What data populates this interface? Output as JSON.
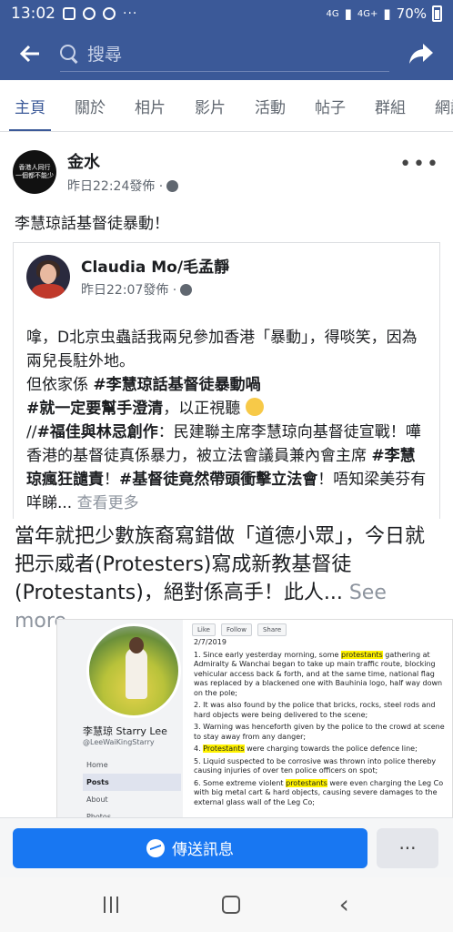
{
  "status_bar": {
    "time": "13:02",
    "dots": "···",
    "signal1": "4G",
    "signal2": "4G+",
    "battery": "70%"
  },
  "appbar": {
    "search_placeholder": "搜尋"
  },
  "tabs": [
    "主頁",
    "關於",
    "相片",
    "影片",
    "活動",
    "帖子",
    "群組",
    "網誌"
  ],
  "post": {
    "author": "金水",
    "avatar_text_line1": "香港人同行",
    "avatar_text_line2": "一個都不能少",
    "time": "昨日22:24發佈 ·",
    "text": "李慧琼話基督徒暴動！",
    "more": "•••"
  },
  "shared": {
    "author": "Claudia Mo/毛孟靜",
    "time": "昨日22:07發佈 ·",
    "line1": "嗱，D北京虫蟲話我兩兒參加香港「暴動」，得啖笑，因為兩兒長駐外地。",
    "line2_pre": "但依家係 ",
    "line2_bold": "#李慧琼話基督徒暴動喎",
    "line3_bold": "#就一定要幫手澄清",
    "line3_post": "，以正視聽 ",
    "line4_pre": "//",
    "line4_bold": "#福佳與林忌創作",
    "line4_post": "：民建聯主席李慧琼向基督徒宣戰！嘩香港的基督徒真係暴力，被立法會議員兼內會主席 ",
    "line4_tag1": "#李慧琼瘋狂譴責",
    "line4_mid": "！",
    "line4_tag2": "#基督徒竟然帶頭衝擊立法會",
    "line4_end": "！唔知梁美芬有咩睇... ",
    "see_more": "查看更多"
  },
  "block2": {
    "text": "當年就把少數族裔寫錯做「道德小眾」，今日就把示威者(Protesters)寫成新教基督徒(Protestants)，絕對係高手！此人... ",
    "see_more": "See more"
  },
  "image": {
    "name": "李慧琼 Starry Lee",
    "handle": "@LeeWaiKingStarry",
    "nav": [
      "Home",
      "Posts",
      "About",
      "Photos"
    ],
    "buttons": [
      "Like",
      "Follow",
      "Share"
    ],
    "date": "2/7/2019",
    "items": [
      {
        "pre": "1. Since early yesterday morning, some ",
        "hl": "protestants",
        "post": " gathering at Admiralty & Wanchai began to take up main traffic route, blocking vehicular access back & forth, and at the same time, national flag was replaced by a blackened one with Bauhinia logo, half way down on the pole;"
      },
      {
        "pre": "2. It was also found by the police that bricks, rocks, steel rods and hard objects were being delivered to the scene;",
        "hl": "",
        "post": ""
      },
      {
        "pre": "3. Warning was henceforth given by the police to the crowd at scene to stay away from any danger;",
        "hl": "",
        "post": ""
      },
      {
        "pre": "4. ",
        "hl": "Protestants",
        "post": " were charging towards the police defence line;"
      },
      {
        "pre": "5. Liquid suspected to be corrosive was thrown into police thereby causing injuries of over ten police officers on spot;",
        "hl": "",
        "post": ""
      },
      {
        "pre": "6. Some extreme violent ",
        "hl": "protestants",
        "post": " were even charging the Leg Co with big metal cart & hard objects, causing severe damages to the external glass wall of the Leg Co;"
      }
    ]
  },
  "actionbar": {
    "message_label": "傳送訊息",
    "more_label": "···"
  }
}
